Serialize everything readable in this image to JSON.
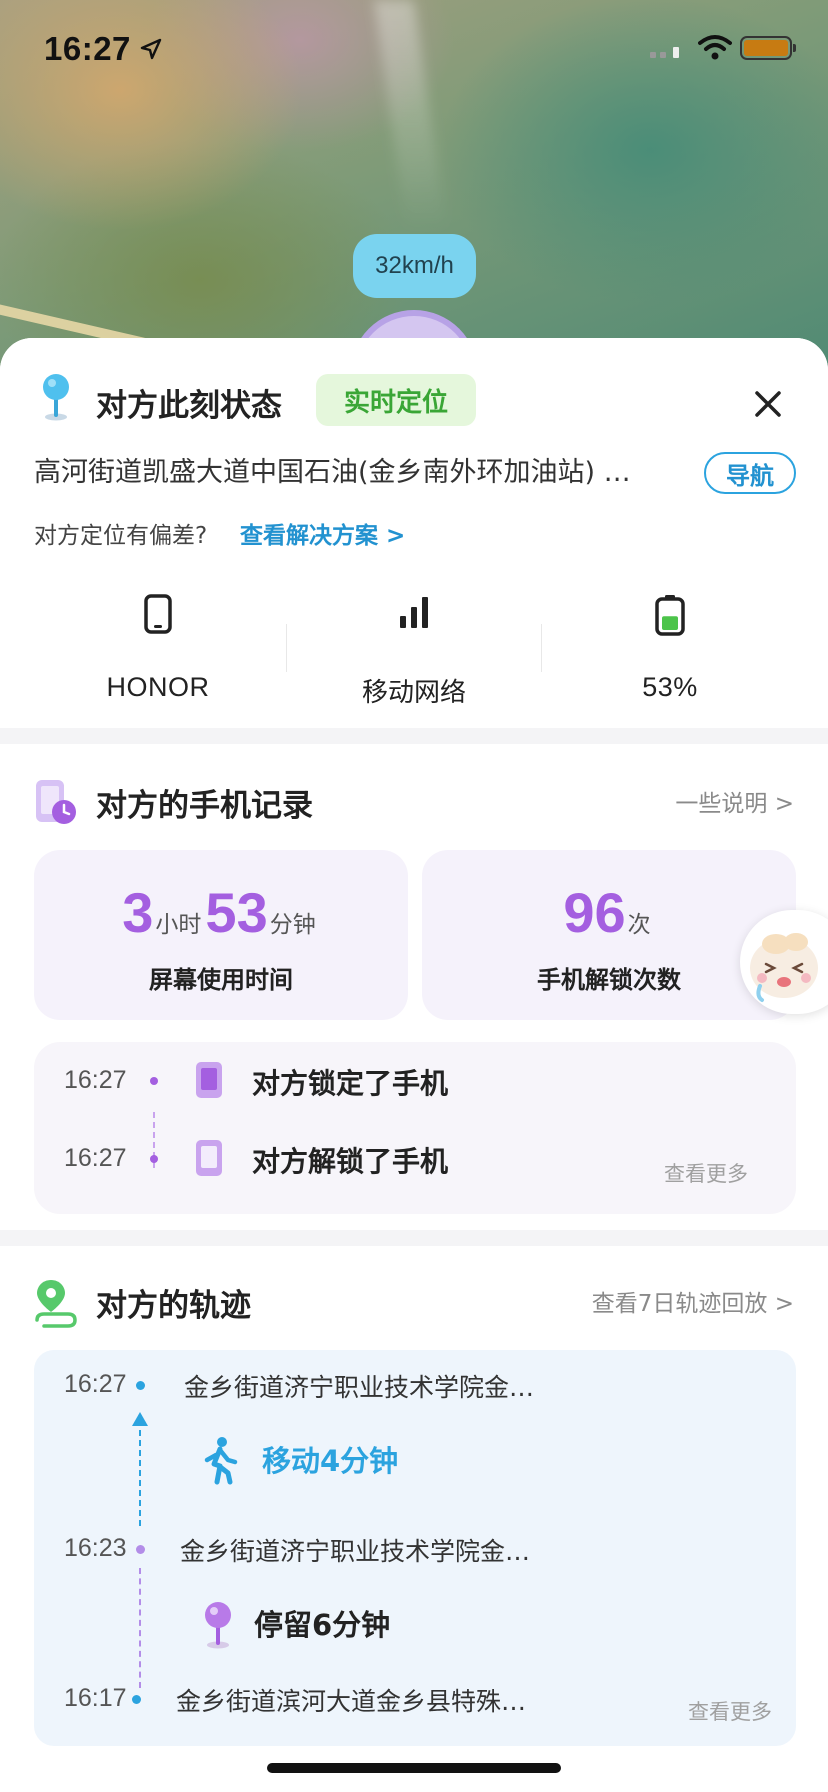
{
  "status_bar": {
    "time": "16:27"
  },
  "map": {
    "speed": "32km/h"
  },
  "status": {
    "title": "对方此刻状态",
    "badge": "实时定位",
    "address": "高河街道凯盛大道中国石油(金乡南外环加油站) …",
    "nav_button": "导航",
    "hint": "对方定位有偏差?",
    "hint_link": "查看解决方案 >",
    "device": [
      {
        "icon": "phone-icon",
        "label": "HONOR"
      },
      {
        "icon": "signal-icon",
        "label": "移动网络"
      },
      {
        "icon": "battery-icon",
        "label": "53%"
      }
    ],
    "battery_level": 0.53
  },
  "phone_records": {
    "title": "对方的手机记录",
    "more": "一些说明 >",
    "screen_time": {
      "hours": "3",
      "hour_unit": "小时",
      "minutes": "53",
      "minute_unit": "分钟",
      "caption": "屏幕使用时间"
    },
    "unlocks": {
      "count": "96",
      "unit": "次",
      "caption": "手机解锁次数"
    },
    "records": [
      {
        "time": "16:27",
        "text": "对方锁定了手机"
      },
      {
        "time": "16:27",
        "text": "对方解锁了手机"
      }
    ],
    "view_more": "查看更多"
  },
  "track": {
    "title": "对方的轨迹",
    "more": "查看7日轨迹回放 >",
    "points": [
      {
        "time": "16:27",
        "place": "金乡街道济宁职业技术学院金…"
      },
      {
        "time": "16:23",
        "place": "金乡街道济宁职业技术学院金…"
      },
      {
        "time": "16:17",
        "place": "金乡街道滨河大道金乡县特殊…"
      }
    ],
    "move": "移动4分钟",
    "stay": "停留6分钟",
    "view_more": "查看更多"
  },
  "colors": {
    "accent_purple": "#a45fe0",
    "accent_blue": "#2ba3df",
    "green_badge": "#3aa636",
    "battery_green": "#4cc44a"
  }
}
